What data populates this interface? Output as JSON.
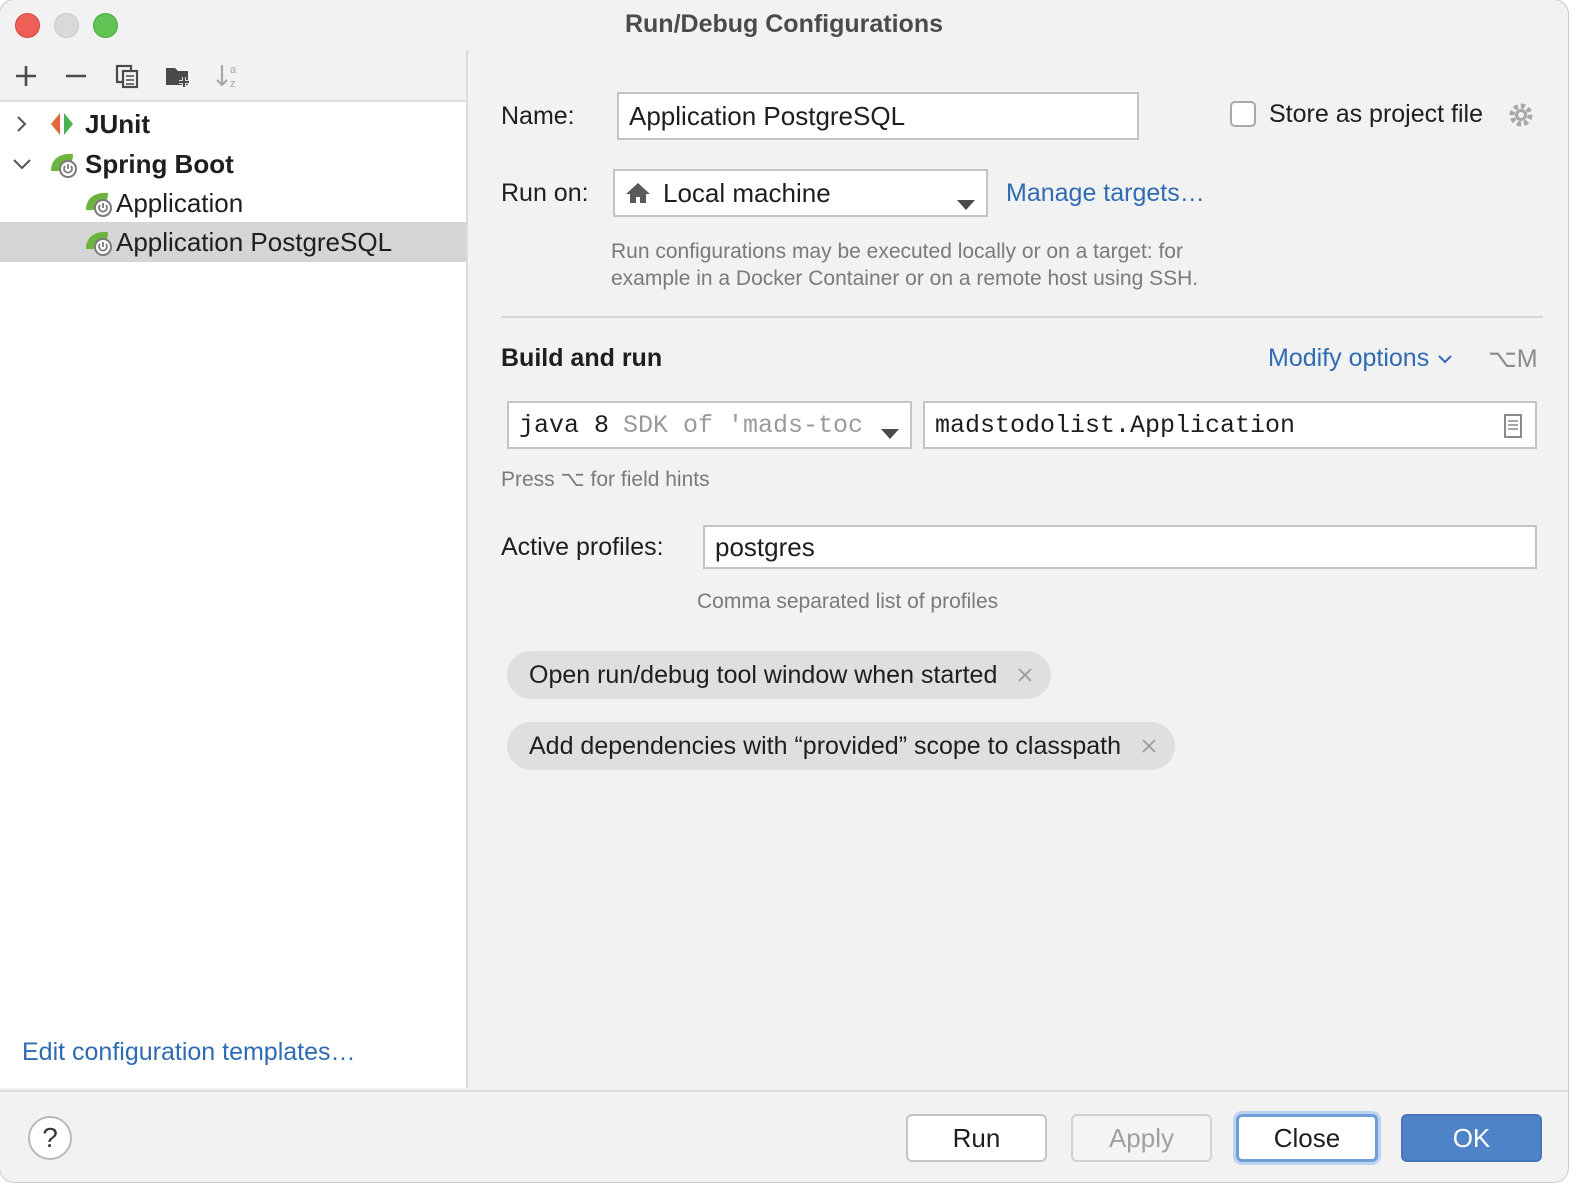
{
  "window": {
    "title": "Run/Debug Configurations"
  },
  "sidebar": {
    "toolbar": [
      "add-icon",
      "remove-icon",
      "copy-icon",
      "new-folder-icon",
      "sort-icon"
    ],
    "tree": {
      "junit": {
        "label": "JUnit"
      },
      "spring_boot": {
        "label": "Spring Boot"
      },
      "items": [
        {
          "label": "Application"
        },
        {
          "label": "Application PostgreSQL"
        }
      ]
    },
    "edit_templates": "Edit configuration templates…"
  },
  "form": {
    "name_label": "Name:",
    "name_value": "Application PostgreSQL",
    "store_label": "Store as project file",
    "store_checked": false,
    "run_on_label": "Run on:",
    "run_on_value": "Local machine",
    "manage_targets": "Manage targets…",
    "run_on_hint_1": "Run configurations may be executed locally or on a target: for",
    "run_on_hint_2": "example in a Docker Container or on a remote host using SSH.",
    "build_and_run": "Build and run",
    "modify_options": "Modify options",
    "modify_shortcut": "⌥M",
    "jdk_main": "java 8",
    "jdk_detail": "SDK of 'mads-toc",
    "main_class": "madstodolist.Application",
    "field_hint": "Press ⌥ for field hints",
    "active_profiles_label": "Active profiles:",
    "active_profiles_value": "postgres",
    "active_profiles_hint": "Comma separated list of profiles",
    "chips": [
      "Open run/debug tool window when started",
      "Add dependencies with “provided” scope to classpath"
    ]
  },
  "footer": {
    "help": "?",
    "run": "Run",
    "apply": "Apply",
    "close": "Close",
    "ok": "OK"
  },
  "colors": {
    "link": "#2f6bb3",
    "primary_button": "#4f83c8",
    "selection": "#d5d5d5",
    "spring_green": "#6db33f"
  }
}
